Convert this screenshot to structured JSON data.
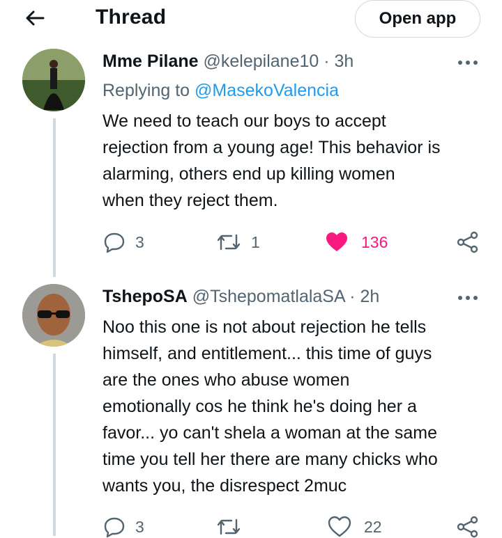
{
  "header": {
    "title": "Thread",
    "open_app_label": "Open app"
  },
  "tweets": [
    {
      "name": "Mme Pilane",
      "handle": "@kelepilane10",
      "time": "· 3h",
      "replying_prefix": "Replying to",
      "replying_to": "@MasekoValencia",
      "lines": [
        "We need to teach our boys to accept",
        "rejection from a young age! This behavior is",
        "alarming, others end up killing women",
        "when they reject them."
      ],
      "replies": "3",
      "retweets": "1",
      "likes": "136",
      "liked": true
    },
    {
      "name": "TshepoSA",
      "handle": "@TshepomatlalaSA",
      "time": "· 2h",
      "lines": [
        "Noo this one is not about rejection he tells",
        "himself, and entitlement... this time of guys",
        "are the ones who abuse women",
        "emotionally cos he think he's doing her a",
        "favor... yo can't shela a woman at the same",
        "time you tell her there are many chicks who",
        "wants you, the disrespect 2muc"
      ],
      "replies": "3",
      "retweets": "",
      "likes": "22",
      "liked": false
    }
  ],
  "colors": {
    "accent": "#1d9bf0",
    "like": "#f91880",
    "muted": "#536471",
    "line": "#cfd9de"
  },
  "icons": [
    "back-arrow-icon",
    "more-icon",
    "reply-icon",
    "retweet-icon",
    "heart-icon",
    "share-icon"
  ]
}
